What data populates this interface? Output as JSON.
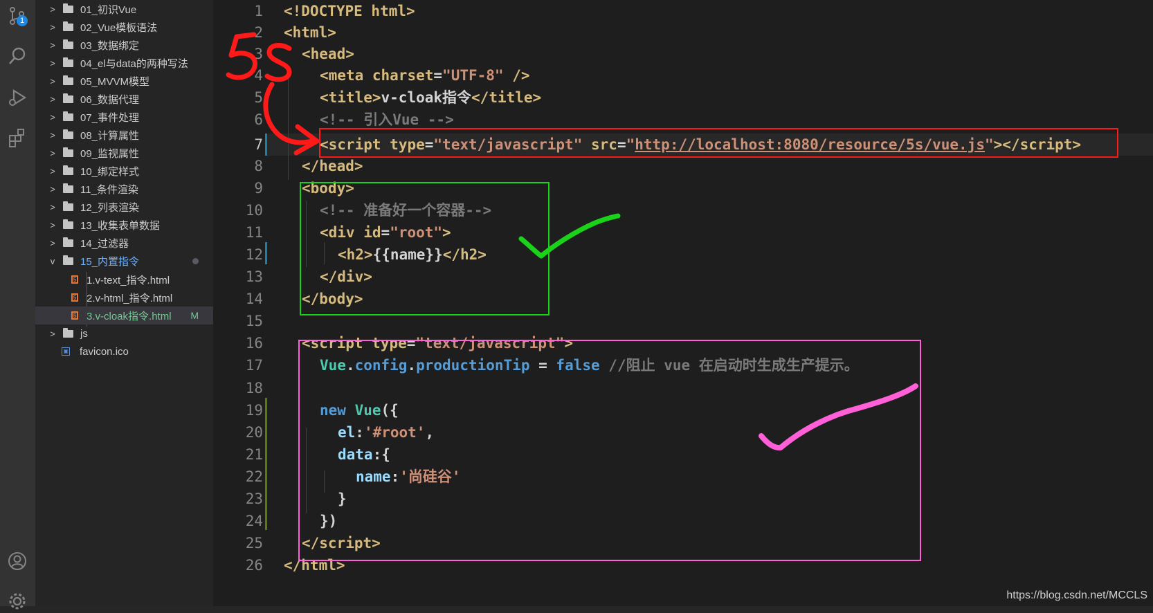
{
  "activity_bar": {
    "icons": [
      "source-control-icon",
      "search-icon",
      "run-debug-icon",
      "extensions-icon",
      "account-icon",
      "settings-icon"
    ],
    "badge": "1"
  },
  "explorer": {
    "folders": [
      {
        "label": "01_初识Vue"
      },
      {
        "label": "02_Vue模板语法"
      },
      {
        "label": "03_数据绑定"
      },
      {
        "label": "04_el与data的两种写法"
      },
      {
        "label": "05_MVVM模型"
      },
      {
        "label": "06_数据代理"
      },
      {
        "label": "07_事件处理"
      },
      {
        "label": "08_计算属性"
      },
      {
        "label": "09_监视属性"
      },
      {
        "label": "10_绑定样式"
      },
      {
        "label": "11_条件渲染"
      },
      {
        "label": "12_列表渲染"
      },
      {
        "label": "13_收集表单数据"
      },
      {
        "label": "14_过滤器"
      }
    ],
    "open_folder": {
      "label": "15_内置指令"
    },
    "files": [
      {
        "label": "1.v-text_指令.html"
      },
      {
        "label": "2.v-html_指令.html"
      },
      {
        "label": "3.v-cloak指令.html",
        "status": "M"
      }
    ],
    "js_folder": {
      "label": "js"
    },
    "favicon": {
      "label": "favicon.ico"
    }
  },
  "editor": {
    "line_numbers": [
      "1",
      "2",
      "3",
      "4",
      "5",
      "6",
      "7",
      "8",
      "9",
      "10",
      "11",
      "12",
      "13",
      "14",
      "15",
      "16",
      "17",
      "18",
      "19",
      "20",
      "21",
      "22",
      "23",
      "24",
      "25",
      "26"
    ],
    "active_line": "7",
    "code": {
      "l1": "<!DOCTYPE html>",
      "l5_title_text": "v-cloak指令",
      "l6_comment": "<!-- 引入Vue -->",
      "l7_src": "http://localhost:8080/resource/5s/vue.js",
      "l10_comment": "<!-- 准备好一个容器-->",
      "l11_id": "\"root\"",
      "l12_mustache": "{{name}}",
      "l17_comment": "//阻止 vue 在启动时生成生产提示。",
      "l20_el": "'#root'",
      "l22_name": "'尚硅谷'"
    }
  },
  "annotations": {
    "handwritten_text": "5s",
    "colors": {
      "red": "#ff1a1a",
      "green": "#19d219",
      "pink": "#ff5fd7"
    }
  },
  "watermark": "https://blog.csdn.net/MCCLS"
}
